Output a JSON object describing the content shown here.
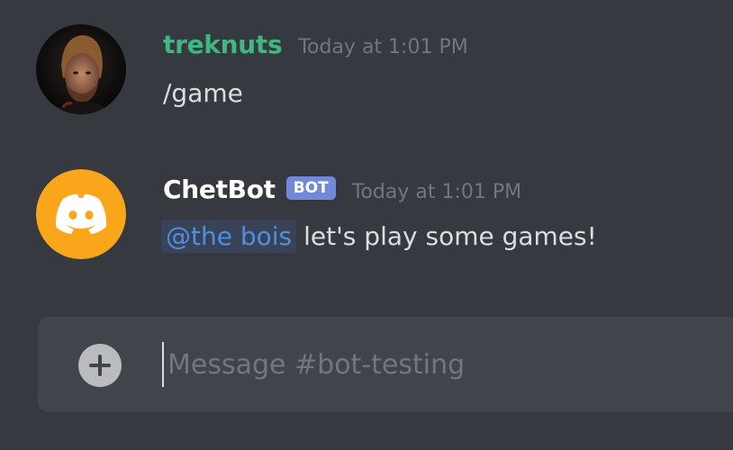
{
  "messages": [
    {
      "author": "treknuts",
      "timestamp": "Today at 1:01 PM",
      "content": "/game",
      "avatar_icon": "user-photo-avatar"
    },
    {
      "author": "ChetBot",
      "bot_tag": "BOT",
      "timestamp": "Today at 1:01 PM",
      "mention": "@the bois",
      "content": "let's play some games!",
      "avatar_icon": "discord-logo-icon"
    }
  ],
  "composer": {
    "placeholder": "Message #bot-testing",
    "attach_icon": "plus-circle-icon"
  },
  "colors": {
    "background": "#36393f",
    "composer": "#40444b",
    "user_name": "#43b581",
    "bot_badge": "#7289da",
    "bot_avatar": "#faa61a",
    "mention_bg": "#3a4257",
    "mention_text": "#4e8fe0",
    "timestamp": "#72767d"
  }
}
